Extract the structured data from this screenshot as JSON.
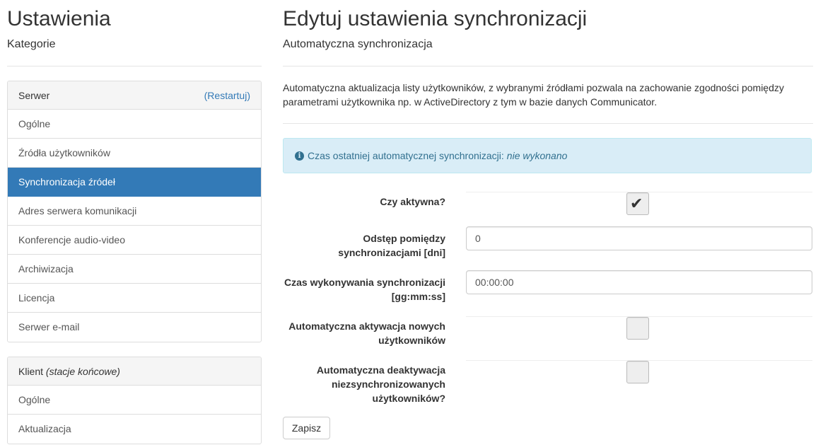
{
  "sidebar": {
    "title": "Ustawienia",
    "subtitle": "Kategorie",
    "server_panel": {
      "heading": "Serwer",
      "restart_link": "(Restartuj)",
      "items": [
        {
          "label": "Ogólne"
        },
        {
          "label": "Źródła użytkowników"
        },
        {
          "label": "Synchronizacja źródeł",
          "active": true
        },
        {
          "label": "Adres serwera komunikacji"
        },
        {
          "label": "Konferencje audio-video"
        },
        {
          "label": "Archiwizacja"
        },
        {
          "label": "Licencja"
        },
        {
          "label": "Serwer e-mail"
        }
      ]
    },
    "client_panel": {
      "heading": "Klient",
      "heading_note": "(stacje końcowe)",
      "items": [
        {
          "label": "Ogólne"
        },
        {
          "label": "Aktualizacja"
        }
      ]
    }
  },
  "main": {
    "title": "Edytuj ustawienia synchronizacji",
    "subtitle": "Automatyczna synchronizacja",
    "description": "Automatyczna aktualizacja listy użytkowników, z wybranymi źródłami pozwala na zachowanie zgodności pomiędzy parametrami użytkownika np. w ActiveDirectory z tym w bazie danych Communicator.",
    "alert": {
      "text": "Czas ostatniej automatycznej synchronizacji:",
      "value": "nie wykonano"
    },
    "form": {
      "active_label": "Czy aktywna?",
      "active_checked": true,
      "interval_label": "Odstęp pomiędzy synchronizacjami [dni]",
      "interval_value": "0",
      "time_label": "Czas wykonywania synchronizacji [gg:mm:ss]",
      "time_value": "00:00:00",
      "auto_activate_label": "Automatyczna aktywacja nowych użytkowników",
      "auto_activate_checked": false,
      "auto_deactivate_label": "Automatyczna deaktywacja niezsynchronizowanych użytkowników?",
      "auto_deactivate_checked": false,
      "save_label": "Zapisz"
    }
  },
  "colors": {
    "accent": "#337ab7",
    "alert_bg": "#d9edf7",
    "alert_text": "#31708f"
  }
}
